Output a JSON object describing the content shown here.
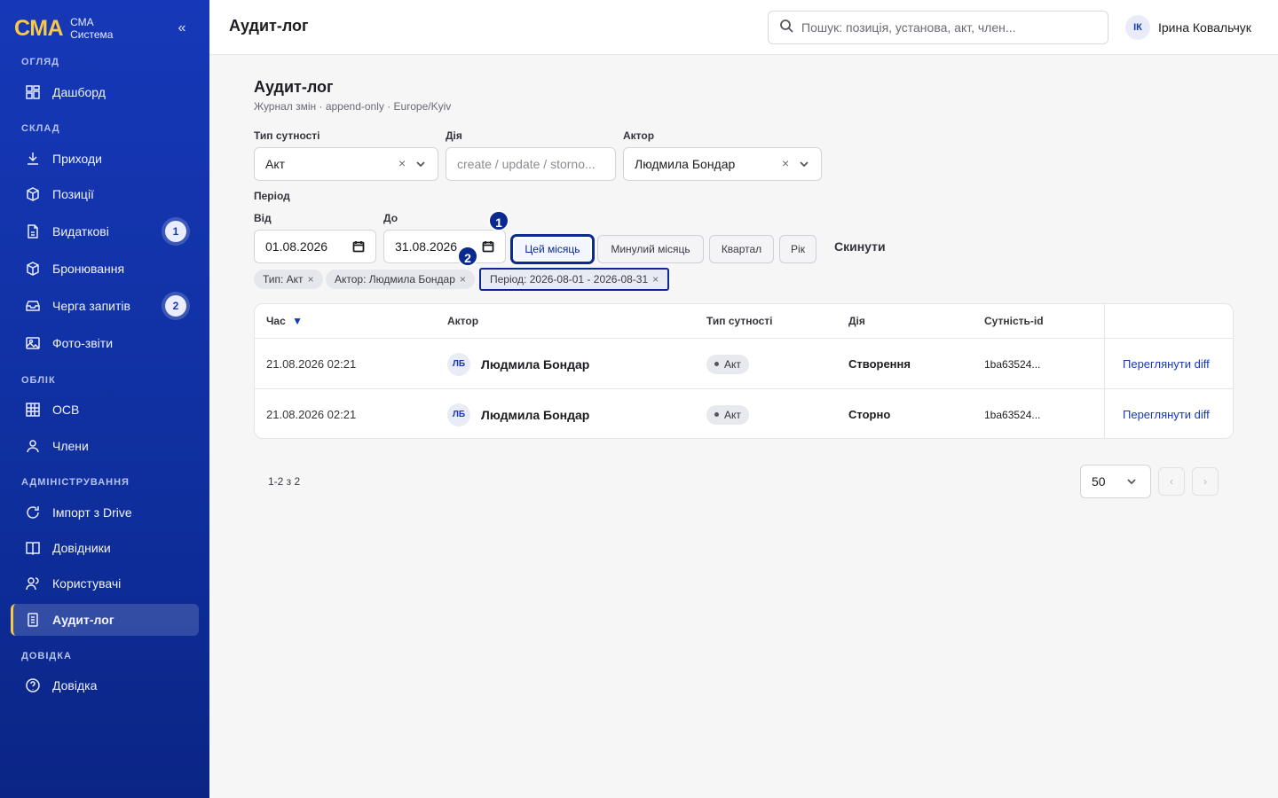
{
  "sidebar": {
    "logo": "СМА",
    "brand_line1": "СМА",
    "brand_line2": "Система",
    "collapse_label": "«",
    "sections": {
      "overview": "Огляд",
      "warehouse": "Склад",
      "accounting": "Облік",
      "admin": "Адміністрування",
      "help": "Довідка"
    },
    "items": {
      "dashboard": "Дашборд",
      "receipts": "Приходи",
      "positions": "Позиції",
      "issues": "Видаткові",
      "issues_badge": "1",
      "bookings": "Бронювання",
      "requests": "Черга запитів",
      "requests_badge": "2",
      "photo_reports": "Фото-звіти",
      "osv": "ОСВ",
      "members": "Члени",
      "drive_import": "Імпорт з Drive",
      "directories": "Довідники",
      "users": "Користувачі",
      "audit_log": "Аудит-лог",
      "help": "Довідка"
    },
    "active_item": "audit_log"
  },
  "topbar": {
    "title": "Аудит-лог",
    "search_placeholder": "Пошук: позиція, установа, акт, член...",
    "user_initials": "ІК",
    "user_name": "Ірина Ковальчук"
  },
  "page": {
    "title": "Аудит-лог",
    "subtitle": "Журнал змін · append-only · Europe/Kyiv"
  },
  "filters": {
    "entity_type_label": "Тип сутності",
    "entity_type_value": "Акт",
    "action_label": "Дія",
    "action_placeholder": "create / update / storno...",
    "actor_label": "Актор",
    "actor_value": "Людмила Бондар",
    "clear_glyph": "×",
    "period_label": "Період",
    "from_label": "Від",
    "from_value": "01.08.2026",
    "to_label": "До",
    "to_value": "31.08.2026",
    "presets": [
      "Цей місяць",
      "Минулий місяць",
      "Квартал",
      "Рік"
    ],
    "active_preset": "Цей місяць",
    "reset_label": "Скинути"
  },
  "markers": {
    "one": "1",
    "two": "2"
  },
  "active_chips": [
    {
      "label": "Тип: Акт"
    },
    {
      "label": "Актор: Людмила Бондар"
    },
    {
      "label": "Період: 2026-08-01 - 2026-08-31"
    }
  ],
  "chip_close": "×",
  "table": {
    "columns": {
      "time": "Час",
      "sort_indicator": "▼",
      "actor": "Актор",
      "entity_type": "Тип сутності",
      "action": "Дія",
      "entity_id": "Сутність-id"
    },
    "rows": [
      {
        "time": "21.08.2026 02:21",
        "actor_initials": "ЛБ",
        "actor": "Людмила Бондар",
        "entity_type": "Акт",
        "action": "Створення",
        "entity_id": "1ba63524...",
        "link": "Переглянути diff"
      },
      {
        "time": "21.08.2026 02:21",
        "actor_initials": "ЛБ",
        "actor": "Людмила Бондар",
        "entity_type": "Акт",
        "action": "Сторно",
        "entity_id": "1ba63524...",
        "link": "Переглянути diff"
      }
    ]
  },
  "pagination": {
    "count_text": "1-2 з 2",
    "page_size": "50",
    "prev_glyph": "‹",
    "next_glyph": "›"
  },
  "colors": {
    "sidebar_top": "#1638b8",
    "sidebar_bottom": "#0a2585",
    "accent_yellow": "#f7c948",
    "link_blue": "#1638b8",
    "marker_blue": "#0b2a8f"
  }
}
